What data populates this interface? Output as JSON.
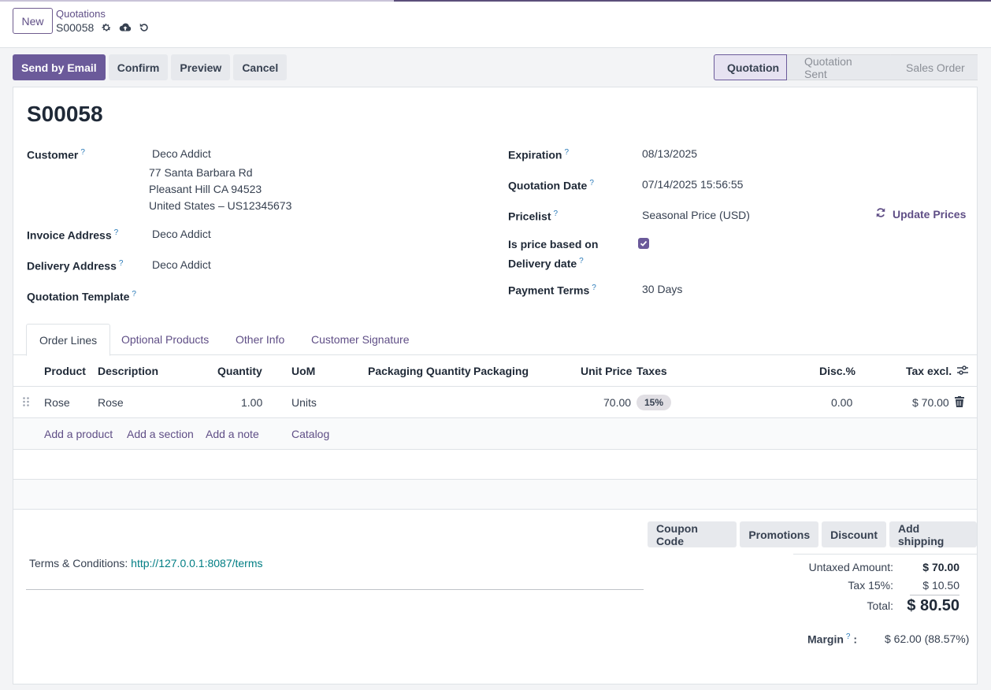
{
  "control_panel": {
    "new_label": "New",
    "breadcrumb_parent": "Quotations",
    "breadcrumb_current": "S00058"
  },
  "actions": [
    "Send by Email",
    "Confirm",
    "Preview",
    "Cancel"
  ],
  "status": [
    "Quotation",
    "Quotation Sent",
    "Sales Order"
  ],
  "record": {
    "title": "S00058",
    "customer_label": "Customer",
    "customer_name": "Deco Addict",
    "customer_address": [
      "77 Santa Barbara Rd",
      "Pleasant Hill CA 94523",
      "United States – US12345673"
    ],
    "invoice_label": "Invoice Address",
    "invoice_value": "Deco Addict",
    "delivery_label": "Delivery Address",
    "delivery_value": "Deco Addict",
    "template_label": "Quotation Template",
    "expiration_label": "Expiration",
    "expiration_value": "08/13/2025",
    "qdate_label": "Quotation Date",
    "qdate_value": "07/14/2025 15:56:55",
    "pricelist_label": "Pricelist",
    "pricelist_value": "Seasonal Price (USD)",
    "update_prices": "Update Prices",
    "price_based_label_1": "Is price based on",
    "price_based_label_2": "Delivery date",
    "payment_terms_label": "Payment Terms",
    "payment_terms_value": "30 Days",
    "help_mark": "?"
  },
  "tabs": [
    "Order Lines",
    "Optional Products",
    "Other Info",
    "Customer Signature"
  ],
  "table": {
    "headers": [
      "Product",
      "Description",
      "Quantity",
      "UoM",
      "Packaging Quantity",
      "Packaging",
      "Unit Price",
      "Taxes",
      "Disc.%",
      "Tax excl."
    ],
    "rows": [
      {
        "product": "Rose",
        "description": "Rose",
        "quantity": "1.00",
        "uom": "Units",
        "unit_price": "70.00",
        "taxes": "15%",
        "disc": "0.00",
        "subtotal": "$ 70.00"
      }
    ],
    "add_links": [
      "Add a product",
      "Add a section",
      "Add a note",
      "Catalog"
    ]
  },
  "footer_buttons": [
    "Coupon Code",
    "Promotions",
    "Discount",
    "Add shipping"
  ],
  "terms": {
    "label": "Terms & Conditions:",
    "link": "http://127.0.0.1:8087/terms"
  },
  "totals": {
    "untaxed_label": "Untaxed Amount:",
    "untaxed_value": "$ 70.00",
    "tax_label": "Tax 15%:",
    "tax_value": "$ 10.50",
    "total_label": "Total:",
    "total_value": "$ 80.50",
    "margin_label": "Margin",
    "margin_value": "$ 62.00 (88.57%)"
  },
  "colors": {
    "primary": "#6b5a9a",
    "link": "#5f4e86",
    "help": "#2b7bb9",
    "terms_link": "#017e84"
  }
}
